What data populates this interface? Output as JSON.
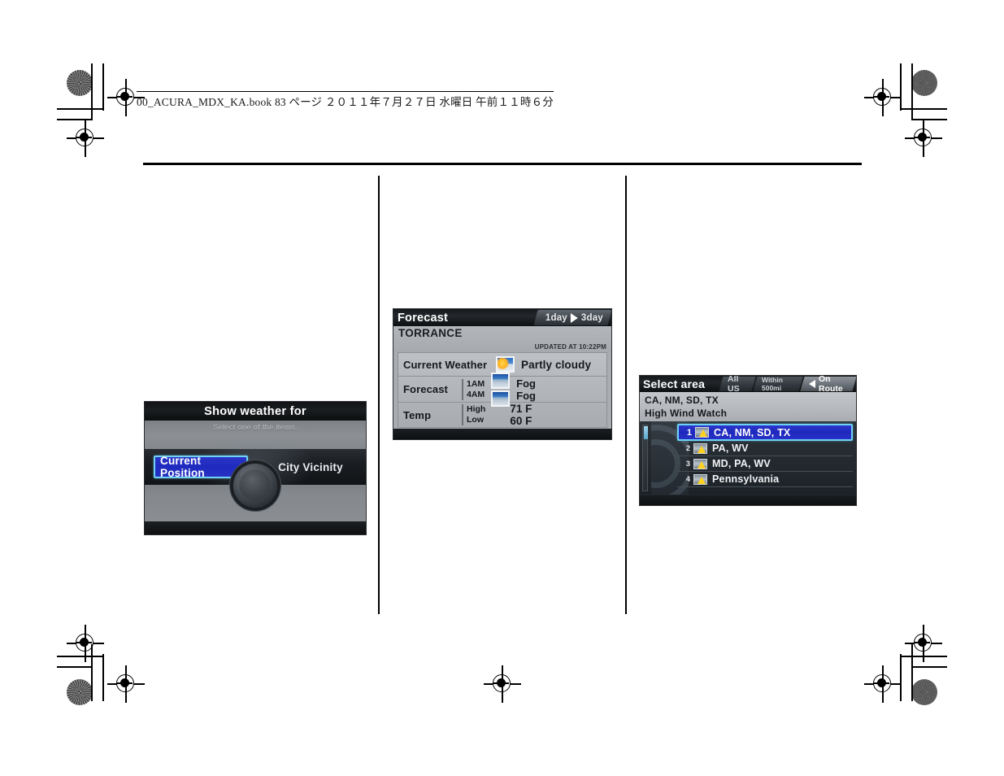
{
  "page_header": {
    "text": "00_ACURA_MDX_KA.book   83 ページ   ２０１１年７月２７日   水曜日   午前１１時６分"
  },
  "screens": {
    "weather_for": {
      "title": "Show weather for",
      "subtitle": "Select one of the items.",
      "buttons": [
        {
          "label": "Current Position",
          "selected": true
        },
        {
          "label": "City Vicinity",
          "selected": false
        }
      ],
      "knob_icon": "joystick-knob-icon",
      "colors": {
        "selected_fill": "#2630c4",
        "selected_border": "#6fd2f5"
      }
    },
    "forecast": {
      "title": "Forecast",
      "tabs": [
        {
          "label": "1day",
          "selected": false
        },
        {
          "label": "3day",
          "selected": false
        }
      ],
      "arrow_icon": "play-arrow-icon",
      "city": "TORRANCE",
      "updated": "UPDATED AT 10:22PM",
      "rows": [
        {
          "label": "Current Weather",
          "icon": "partly-cloudy-icon",
          "value": "Partly cloudy"
        },
        {
          "label": "Forecast",
          "times": [
            "1AM",
            "4AM"
          ],
          "icons": [
            "fog-icon",
            "fog-icon"
          ],
          "values": [
            "Fog",
            "Fog"
          ]
        },
        {
          "label": "Temp",
          "keys": [
            "High",
            "Low"
          ],
          "values": [
            "71 F",
            "60 F"
          ]
        }
      ]
    },
    "select_area": {
      "title": "Select area",
      "tabs": [
        {
          "label": "All US",
          "selected": false
        },
        {
          "label": "Within 500mi",
          "selected": false
        },
        {
          "label": "On Route",
          "selected": true
        }
      ],
      "arrow_icon": "left-arrow-icon",
      "header_lines": [
        "CA, NM, SD, TX",
        "High Wind Watch"
      ],
      "list": [
        {
          "num": "1",
          "icon": "weather-alert-icon",
          "label": "CA, NM, SD, TX",
          "selected": true
        },
        {
          "num": "2",
          "icon": "weather-alert-icon",
          "label": "PA, WV",
          "selected": false
        },
        {
          "num": "3",
          "icon": "weather-alert-icon",
          "label": "MD, PA, WV",
          "selected": false
        },
        {
          "num": "4",
          "icon": "weather-alert-icon",
          "label": "Pennsylvania",
          "selected": false
        }
      ],
      "scrollbar": {
        "position": "top"
      },
      "colors": {
        "selected_fill": "#1f29bd",
        "selected_border": "#6fd2f5"
      }
    }
  }
}
